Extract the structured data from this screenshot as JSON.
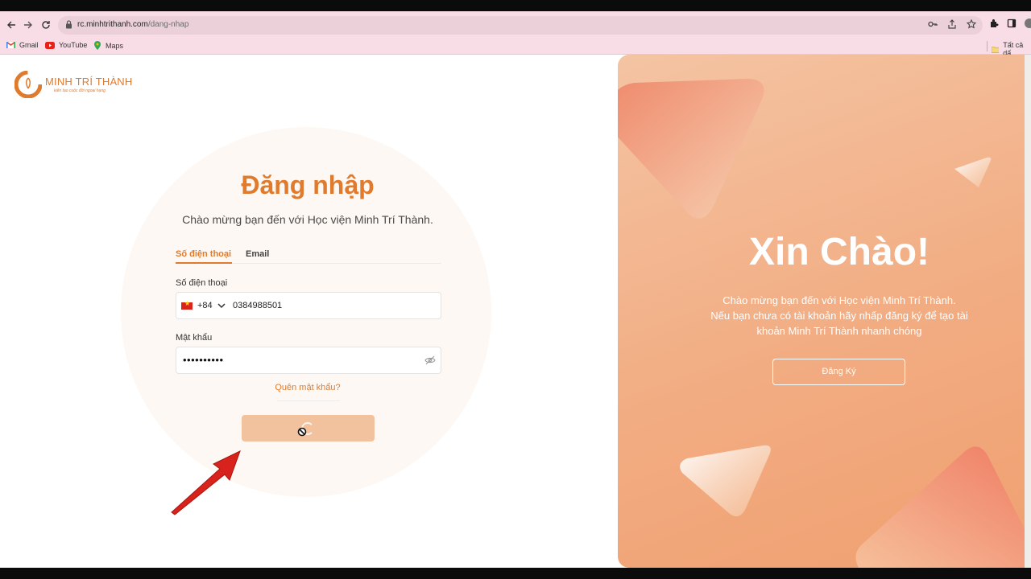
{
  "browser": {
    "url_host": "rc.minhtrithanh.com",
    "url_path": "/dang-nhap",
    "bookmarks": [
      {
        "label": "Gmail"
      },
      {
        "label": "YouTube"
      },
      {
        "label": "Maps"
      }
    ],
    "all_bookmarks_label": "Tất cả dấ"
  },
  "logo": {
    "name": "MINH TRÍ THÀNH",
    "slogan": "kiến tạo cuộc đời ngoại hạng"
  },
  "login": {
    "title": "Đăng nhập",
    "subtitle": "Chào mừng bạn đến với Học viện Minh Trí Thành.",
    "tabs": [
      {
        "label": "Số điện thoại",
        "active": true
      },
      {
        "label": "Email",
        "active": false
      }
    ],
    "phone_label": "Số điện thoại",
    "country_code": "+84",
    "phone_value": "0384988501",
    "password_label": "Mật khẩu",
    "password_value": "••••••••••",
    "forgot_label": "Quên mật khẩu?"
  },
  "panel": {
    "title": "Xin Chào!",
    "line1": "Chào mừng bạn đến với Học viện Minh Trí Thành.",
    "line2": "Nếu bạn chưa có tài khoản hãy nhấp đăng ký để tạo tài",
    "line3": "khoản Minh Trí Thành nhanh chóng",
    "register_label": "Đăng Ký"
  },
  "colors": {
    "accent": "#e07b2e",
    "button_loading": "#f1c29d",
    "panel_gradient_start": "#f4c4a3",
    "panel_gradient_end": "#f0a070"
  }
}
